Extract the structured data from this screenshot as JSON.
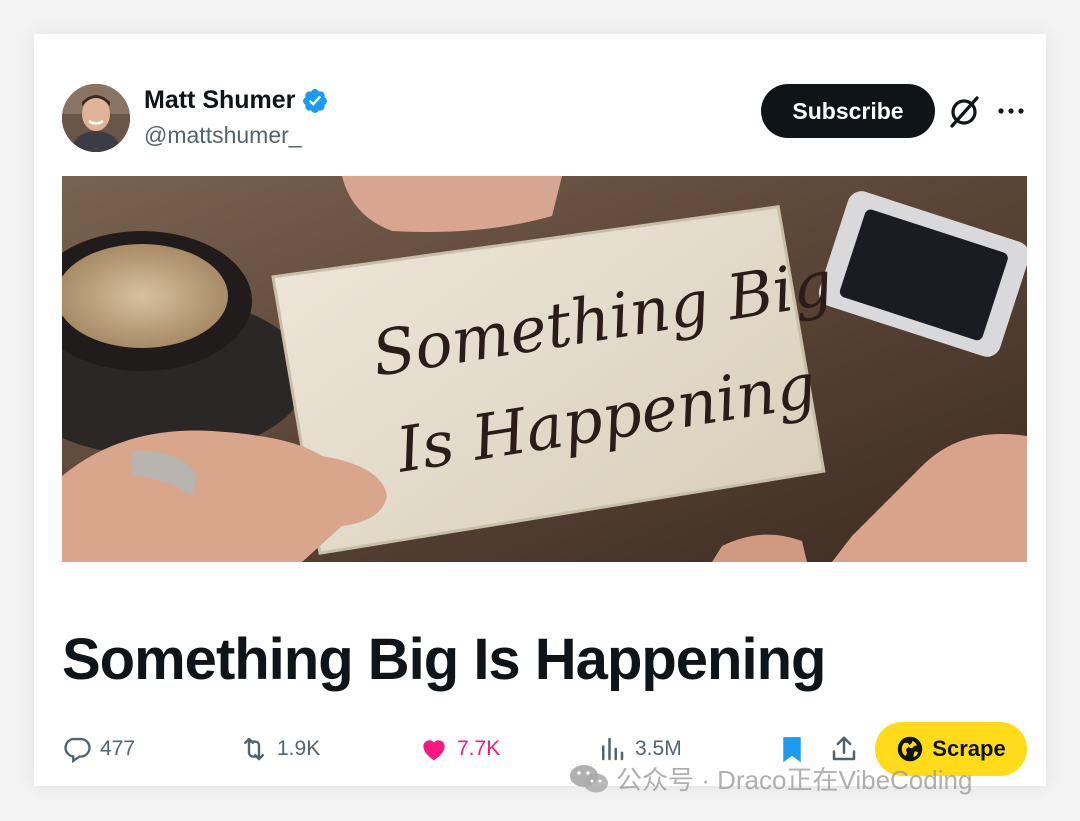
{
  "author": {
    "name": "Matt Shumer",
    "handle": "@mattshumer_",
    "verified": true,
    "verified_color": "#1d9bf0"
  },
  "header_actions": {
    "subscribe_label": "Subscribe",
    "grok_icon": "grok-icon",
    "more_icon": "more-options-icon"
  },
  "hero_image": {
    "note_line1": "Something Big",
    "note_line2": "Is Happening"
  },
  "article": {
    "title": "Something Big Is Happening"
  },
  "stats": {
    "replies": "477",
    "reposts": "1.9K",
    "likes": "7.7K",
    "views": "3.5M",
    "like_color": "#f91880",
    "bookmark_color": "#1d9bf0"
  },
  "scrape_button": {
    "label": "Scrape",
    "color": "#ffdb19"
  },
  "watermark": {
    "text": "公众号 · Draco正在VibeCoding"
  }
}
